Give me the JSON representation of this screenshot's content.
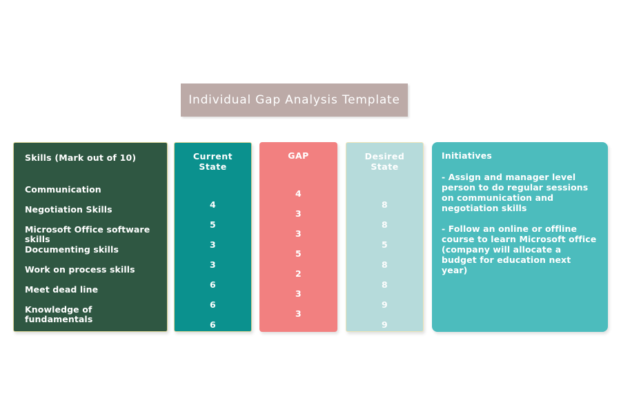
{
  "title": {
    "text": "Individual Gap Analysis Template",
    "background_color": "#BCAAA7",
    "text_color": "#FFFFFF"
  },
  "colors": {
    "page_background": "#FFFFFF",
    "skills_panel": "#2F5742",
    "current_state_panel": "#0B918E",
    "gap_panel": "#F28080",
    "desired_state_panel": "#B6DBDB",
    "initiatives_panel": "#4CBCBD",
    "panel_border": "#D9D394",
    "desired_panel_border": "#EDE4B7"
  },
  "skills_column": {
    "header": "Skills (Mark out of 10)",
    "items": [
      "Communication",
      "Negotiation Skills",
      "Microsoft Office software skills",
      "Documenting skills",
      "Work on process skills",
      "Meet dead line",
      "Knowledge of fundamentals"
    ]
  },
  "current_state_column": {
    "header": "Current\nState",
    "values": [
      "4",
      "5",
      "3",
      "3",
      "6",
      "6",
      "6"
    ]
  },
  "gap_column": {
    "header": "GAP",
    "values": [
      "4",
      "3",
      "3",
      "5",
      "2",
      "3",
      "3"
    ]
  },
  "desired_state_column": {
    "header": "Desired\nState",
    "values": [
      "8",
      "8",
      "5",
      "8",
      "8",
      "9",
      "9"
    ]
  },
  "initiatives_column": {
    "header": "Initiatives",
    "items": [
      "- Assign and manager level person to do regular sessions on communication and negotiation skills",
      "- Follow an online or offline course to learn Microsoft office (company will allocate a budget for education next year)"
    ]
  },
  "chart_data": {
    "type": "table",
    "title": "Individual Gap Analysis Template",
    "columns": [
      "Skills (Mark out of 10)",
      "Current State",
      "GAP",
      "Desired State",
      "Initiatives"
    ],
    "rows": [
      [
        "Communication",
        4,
        4,
        8
      ],
      [
        "Negotiation Skills",
        5,
        3,
        8
      ],
      [
        "Microsoft Office software skills",
        3,
        3,
        5
      ],
      [
        "Documenting skills",
        3,
        5,
        8
      ],
      [
        "Work on process skills",
        6,
        2,
        8
      ],
      [
        "Meet dead line",
        6,
        3,
        9
      ],
      [
        "Knowledge of fundamentals",
        6,
        3,
        9
      ]
    ],
    "scale_max": 10
  }
}
